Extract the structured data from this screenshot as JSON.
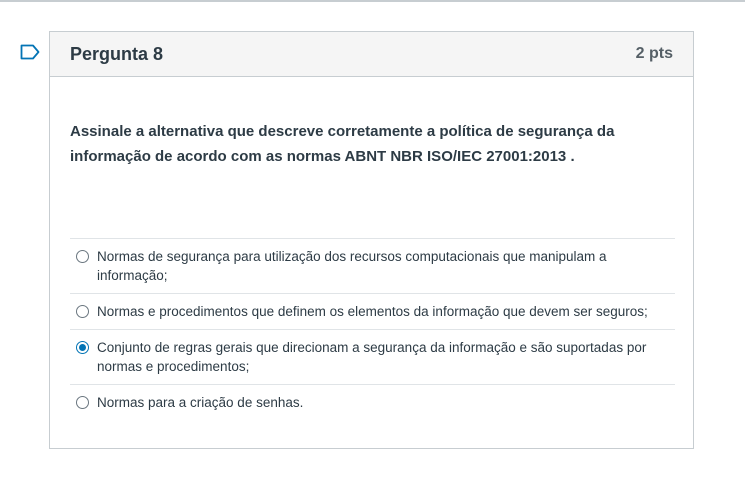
{
  "question": {
    "title": "Pergunta 8",
    "points": "2 pts",
    "text": "Assinale a alternativa que descreve corretamente a política de segurança da informação de acordo com as normas ABNT NBR ISO/IEC 27001:2013 .",
    "answers": [
      {
        "label": "Normas de segurança para utilização dos recursos computacionais que manipulam a informação;",
        "selected": false
      },
      {
        "label": "Normas e procedimentos que definem os elementos da informação que devem ser seguros;",
        "selected": false
      },
      {
        "label": "Conjunto de regras gerais que direcionam a segurança da informação e são suportadas por normas e procedimentos;",
        "selected": true
      },
      {
        "label": "Normas para a criação de senhas.",
        "selected": false
      }
    ]
  },
  "colors": {
    "accent": "#0374b5",
    "bookmark": "#0374b5",
    "header_bg": "#f5f5f5",
    "border": "#c7cdd1"
  },
  "icons": {
    "bookmark": "bookmark-flag-icon",
    "radio": "radio-button-icon"
  }
}
